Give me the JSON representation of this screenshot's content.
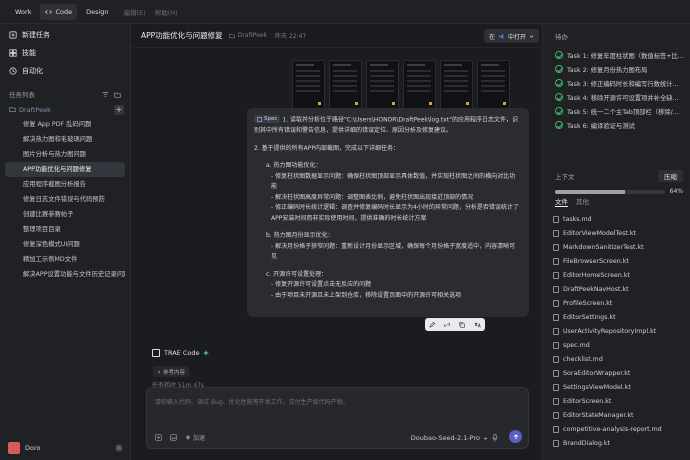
{
  "topbar": {
    "modes": [
      "Work",
      "Code",
      "Design"
    ],
    "active_mode": "Code",
    "menus": [
      "编辑(E)",
      "帮助(H)"
    ]
  },
  "sidebar": {
    "actions": [
      {
        "label": "新建任务",
        "icon": "new-task-icon"
      },
      {
        "label": "技能",
        "icon": "skills-icon"
      },
      {
        "label": "自动化",
        "icon": "automation-icon"
      }
    ],
    "section_title": "任务列表",
    "folder": "DraftPeek",
    "tasks": [
      "修复 App PDF 乱码问题",
      "解决热力图和毛玻璃问题",
      "图片分析与热力图问题",
      "APP功能优化与问题修复",
      "应用程序截图分析报告",
      "修复日志文件错误与代码预防",
      "创建比赛参赛帖子",
      "整理项目目录",
      "修复深色模式UI问题",
      "精加工示例MD文件",
      "解决APP设置功能与文件历史记录问题"
    ],
    "active_task_index": 3,
    "user": "Doro"
  },
  "main": {
    "title": "APP功能优化与问题修复",
    "folder": "DraftPeek",
    "time": "昨天 22:47",
    "open_button": {
      "prefix": "在",
      "label": "中打开"
    },
    "spec_badge": "Spec",
    "spec_lines": [
      {
        "t": "1. 读取并分析位于路径\"C:\\Users\\HONOR\\DraftPeek\\log.txt\"的应用程序日志文件，识",
        "cls": "",
        "badge": true
      },
      {
        "t": "别其中所有错误和警告信息，提供详细的错误定位、原因分析及修复建议。",
        "cls": ""
      },
      {
        "t": "",
        "cls": "gap"
      },
      {
        "t": "2. 基于提供的所有APP内部截图，完成以下详细任务：",
        "cls": ""
      },
      {
        "t": "",
        "cls": "gap"
      },
      {
        "t": "a. 热力图功能优化：",
        "cls": "ind1"
      },
      {
        "t": "- 修复柱状图数据显示问题：确保柱状图顶部显示具体数值，并实现柱状图之间的横向对比功",
        "cls": "ind2"
      },
      {
        "t": "能",
        "cls": "ind2"
      },
      {
        "t": "- 解决柱状图高度异常问题：调整图表比例，避免柱状图出现接近顶部的情况",
        "cls": "ind2"
      },
      {
        "t": "- 修正编码时长统计逻辑：调查并修复编码时长显示为4小时的异常问题，分析是否错误统计了",
        "cls": "ind2"
      },
      {
        "t": "APP安装时间而非实际使用时间，提供准确的时长统计方案",
        "cls": "ind2"
      },
      {
        "t": "",
        "cls": "gap"
      },
      {
        "t": "b. 热力图月份显示优化：",
        "cls": "ind1"
      },
      {
        "t": "- 解决月份格子狭窄问题：重新设计月份显示区域，确保每个月份格子宽度适中，内容清晰可",
        "cls": "ind2"
      },
      {
        "t": "见",
        "cls": "ind2"
      },
      {
        "t": "",
        "cls": "gap"
      },
      {
        "t": "c. 开源许可设置处理：",
        "cls": "ind1"
      },
      {
        "t": "- 修复开源许可设置点击无反应的问题",
        "cls": "ind2"
      },
      {
        "t": "- 由于项目未开源且未上架到仓库，移除设置页面中的开源许可相关选项",
        "cls": "ind2"
      }
    ],
    "agent_name": "TRAE Code",
    "reference_label": "参考内容",
    "elapsed": "任务耗时 51m 47s",
    "input_placeholder": "请你输入代码、调试 Bug、优化性能等开发工作，交付生产级代码产物。",
    "speed_label": "加速",
    "model": "Doubao-Seed-2.1-Pro"
  },
  "right": {
    "todo_title": "待办",
    "todos": [
      "Task 1: 修复年度柱状图（数值标签+比...",
      "Task 2: 修复月份热力图布局",
      "Task 3: 修正编码时长和编写行数统计...",
      "Task 4: 移除开源许可设置项并补全缺...",
      "Task 5: 统一二个主Tab顶部栏（移除/...",
      "Task 6: 编译验证与测试"
    ],
    "context_label": "上下文",
    "compress_label": "压缩",
    "context_percent": "64%",
    "context_fraction": 0.64,
    "tabs": [
      "文件",
      "其他"
    ],
    "files": [
      "tasks.md",
      "EditorViewModelTest.kt",
      "MarkdownSanitizerTest.kt",
      "FileBrowserScreen.kt",
      "EditorHomeScreen.kt",
      "DraftPeekNavHost.kt",
      "ProfileScreen.kt",
      "EditorSettings.kt",
      "UserActivityRepositoryImpl.kt",
      "spec.md",
      "checklist.md",
      "SoraEditorWrapper.kt",
      "SettingsViewModel.kt",
      "EditorScreen.kt",
      "EditorStateManager.kt",
      "competitive-analysis-report.md",
      "BrandDialog.kt"
    ]
  },
  "colors": {
    "accent": "#5b5ec8",
    "check_green": "#3fb56b",
    "active_bg": "#33363c"
  }
}
